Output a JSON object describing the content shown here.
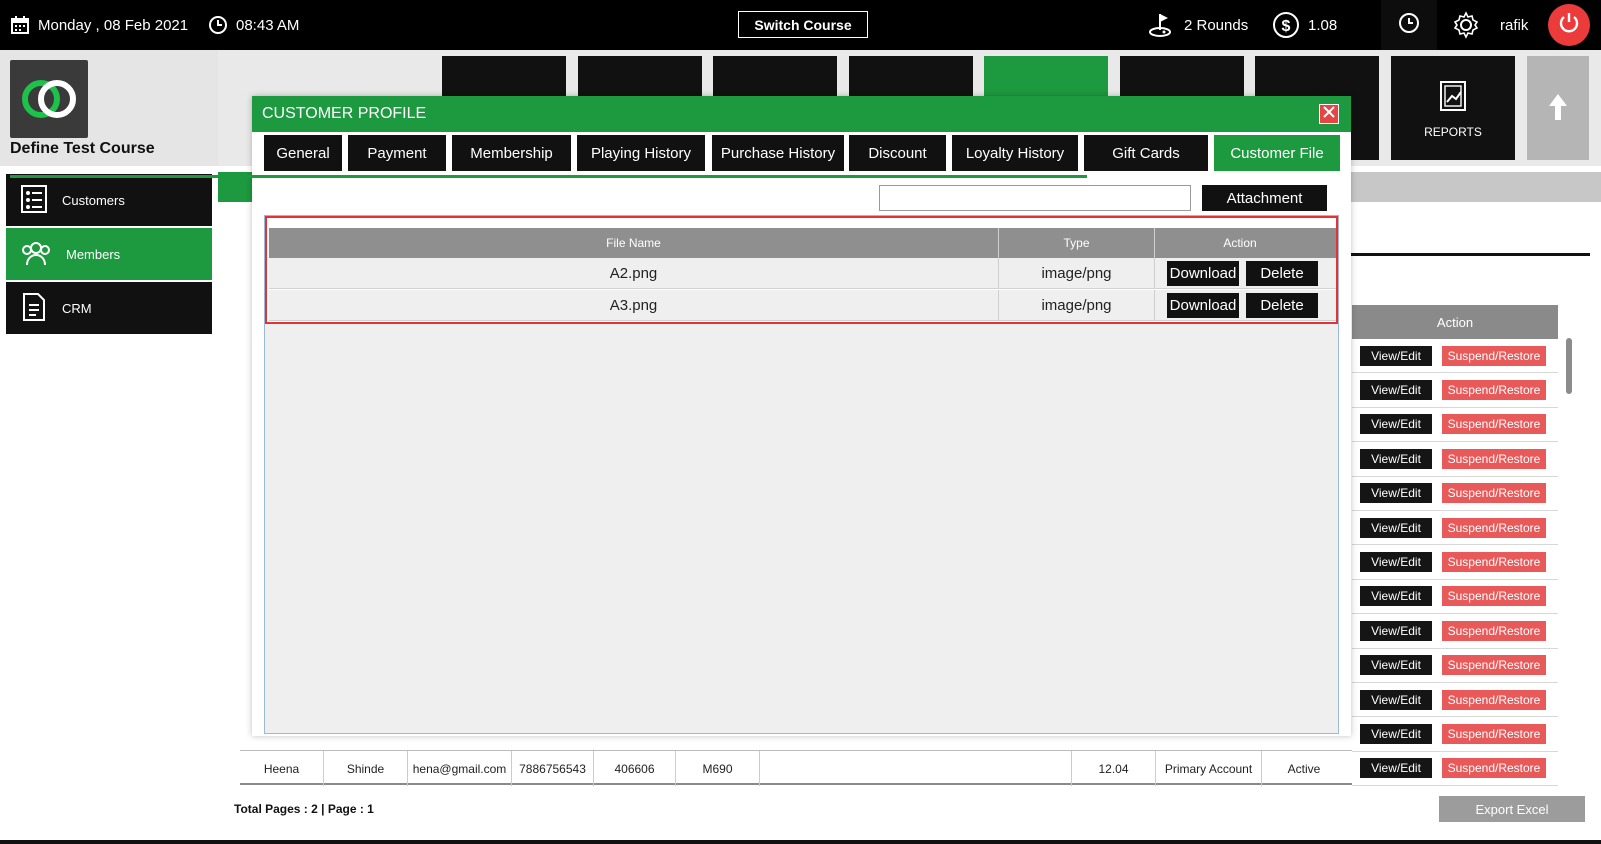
{
  "topbar": {
    "date": "Monday , 08 Feb 2021",
    "time": "08:43 AM",
    "switch_course": "Switch Course",
    "rounds": "2 Rounds",
    "balance": "1.08",
    "user": "rafik",
    "icons": {
      "calendar": "calendar-icon",
      "clock": "clock-icon",
      "golf": "golf-flag-icon",
      "dollar": "dollar-icon",
      "history": "history-icon",
      "settings": "gear-icon",
      "power": "power-icon"
    }
  },
  "brand": {
    "course_name": "Define Test Course",
    "accent": "#1d9a3f",
    "danger": "#e85a5a"
  },
  "sidebar": {
    "items": [
      {
        "label": "Customers",
        "icon": "customers-icon"
      },
      {
        "label": "Members",
        "icon": "members-icon",
        "active": true
      },
      {
        "label": "CRM",
        "icon": "crm-icon"
      }
    ]
  },
  "tiles": {
    "reports_label": "REPORTS"
  },
  "modal": {
    "title": "CUSTOMER PROFILE",
    "tabs": [
      "General",
      "Payment",
      "Membership",
      "Playing History",
      "Purchase History",
      "Discount",
      "Loyalty History",
      "Gift Cards",
      "Customer File"
    ],
    "active_tab": "Customer File",
    "attachment_label": "Attachment",
    "file_table": {
      "columns": [
        "File Name",
        "Type",
        "Action"
      ],
      "rows": [
        {
          "file_name": "A2.png",
          "type": "image/png"
        },
        {
          "file_name": "A3.png",
          "type": "image/png"
        }
      ],
      "download_label": "Download",
      "delete_label": "Delete"
    }
  },
  "background_table": {
    "action_header": "Action",
    "view_edit_label": "View/Edit",
    "suspend_label": "Suspend/Restore",
    "last_row": {
      "first_name": "Heena",
      "last_name": "Shinde",
      "email": "hena@gmail.com",
      "phone": "7886756543",
      "zip": "406606",
      "member_id": "M690",
      "balance": "12.04",
      "account_type": "Primary Account",
      "status": "Active"
    }
  },
  "footer": {
    "pages": "Total Pages : 2 | Page : 1",
    "export": "Export Excel"
  }
}
